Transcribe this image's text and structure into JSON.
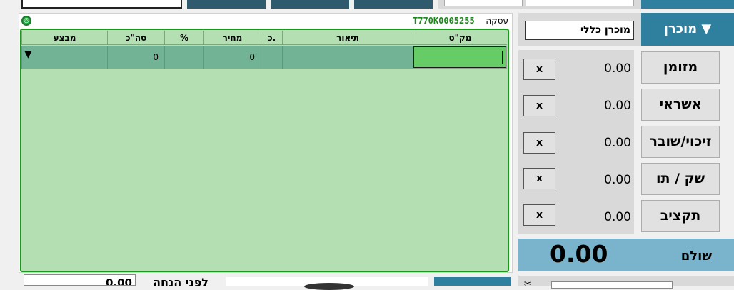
{
  "transaction": {
    "label": "עסקה",
    "id": "T770K0005255"
  },
  "grid": {
    "headers": {
      "code": "מק\"ט",
      "description": "תיאור",
      "qty": "כ.",
      "price": "מחיר",
      "percent": "%",
      "total": "סה\"כ",
      "promo": "מבצע"
    },
    "row": {
      "price": "0",
      "total": "0",
      "arrow": "▼"
    }
  },
  "seller": {
    "button_label": "מוכרן ▼",
    "value": "מוכרן כללי"
  },
  "payments": [
    {
      "label": "מזומן",
      "amount": "0.00",
      "clear": "x"
    },
    {
      "label": "אשראי",
      "amount": "0.00",
      "clear": "x"
    },
    {
      "label": "זיכוי/שובר",
      "amount": "0.00",
      "clear": "x"
    },
    {
      "label": "שק / תו",
      "amount": "0.00",
      "clear": "x"
    },
    {
      "label": "תקציב",
      "amount": "0.00",
      "clear": "x"
    }
  ],
  "paid": {
    "label": "שולם",
    "amount": "0.00"
  },
  "before_discount": {
    "label": "לפני הנחה",
    "amount": "0.00"
  },
  "colors": {
    "teal": "#2f7f9f",
    "grid_bg": "#b3dfb3",
    "row_bg": "#72b396",
    "code_input": "#66cc66",
    "txn_id": "#1a8a1a"
  }
}
